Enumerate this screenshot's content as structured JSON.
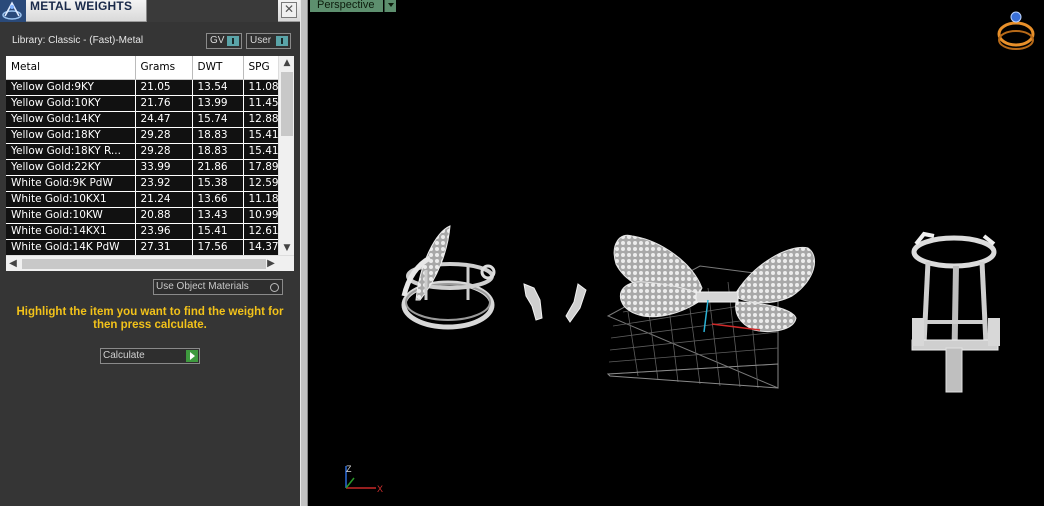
{
  "panel": {
    "title": "METAL WEIGHTS",
    "close_glyph": "✕",
    "library_label": "Library: Classic - (Fast)-Metal",
    "gv_label": "GV",
    "user_label": "User",
    "use_object_materials_label": "Use Object Materials",
    "hint": "Highlight the item you want to find the weight for then press calculate.",
    "calculate_label": "Calculate"
  },
  "table": {
    "columns": [
      "Metal",
      "Grams",
      "DWT",
      "SPG"
    ],
    "rows": [
      [
        "Yellow Gold:9KY",
        "21.05",
        "13.54",
        "11.08"
      ],
      [
        "Yellow Gold:10KY",
        "21.76",
        "13.99",
        "11.45"
      ],
      [
        "Yellow Gold:14KY",
        "24.47",
        "15.74",
        "12.88"
      ],
      [
        "Yellow Gold:18KY",
        "29.28",
        "18.83",
        "15.41"
      ],
      [
        "Yellow Gold:18KY R...",
        "29.28",
        "18.83",
        "15.41"
      ],
      [
        "Yellow Gold:22KY",
        "33.99",
        "21.86",
        "17.89"
      ],
      [
        "White Gold:9K PdW",
        "23.92",
        "15.38",
        "12.59"
      ],
      [
        "White Gold:10KX1",
        "21.24",
        "13.66",
        "11.18"
      ],
      [
        "White Gold:10KW",
        "20.88",
        "13.43",
        "10.99"
      ],
      [
        "White Gold:14KX1",
        "23.96",
        "15.41",
        "12.61"
      ],
      [
        "White Gold:14K PdW",
        "27.31",
        "17.56",
        "14.37"
      ]
    ]
  },
  "viewport": {
    "view_name": "Perspective",
    "axis_x": "X",
    "axis_z": "Z"
  },
  "icons": {
    "app_logo": "app-logo-icon",
    "close": "close-icon",
    "ring_navigator": "ring-navigator-icon",
    "play": "play-icon"
  },
  "colors": {
    "hint_text": "#f2c21a",
    "view_label_bg": "#5d8f6e",
    "toggle_indicator": "#5aa4a8",
    "calculate_play": "#3e9a3e",
    "ring_icon": "#e8902a"
  }
}
